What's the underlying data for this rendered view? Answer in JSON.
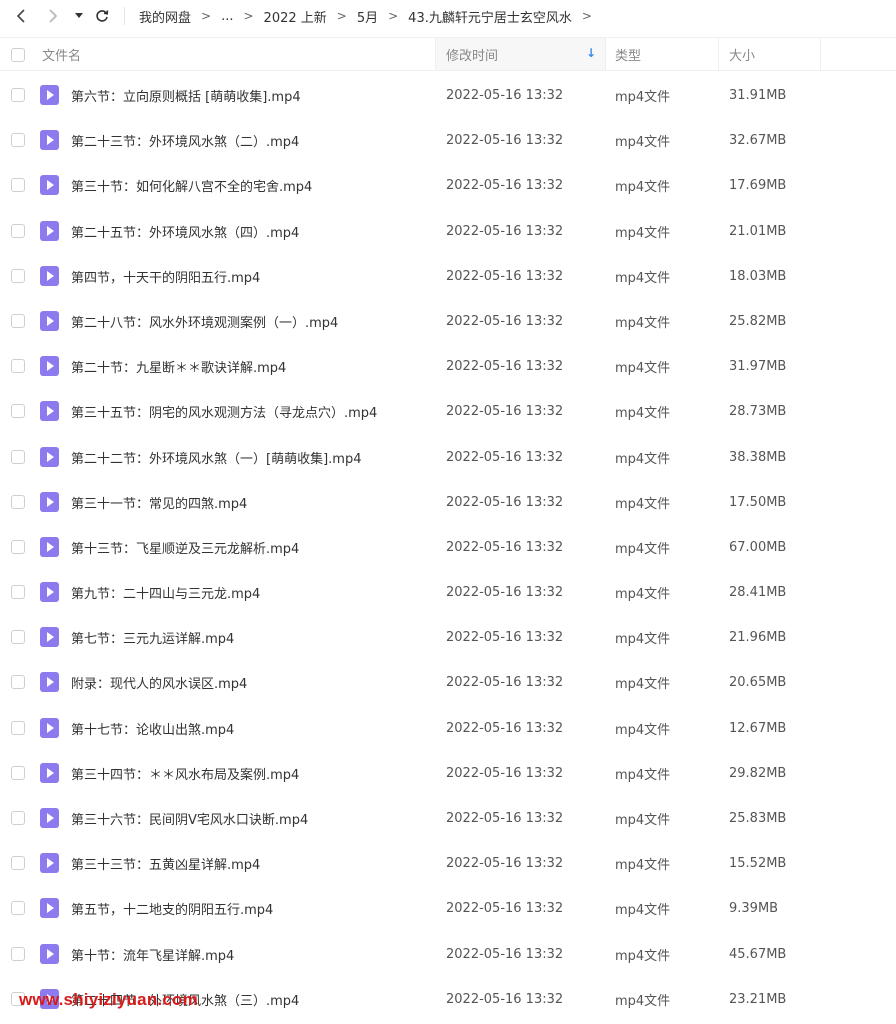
{
  "nav": {
    "back_icon": "chevron-left-icon",
    "forward_icon": "chevron-right-icon",
    "dropdown_icon": "caret-down-icon",
    "refresh_icon": "refresh-icon"
  },
  "breadcrumb": {
    "items": [
      "我的网盘",
      "...",
      "2022 上新",
      "5月",
      "43.九麟轩元宁居士玄空风水"
    ],
    "separator": ">"
  },
  "header": {
    "name": "文件名",
    "modified": "修改时间",
    "type": "类型",
    "size": "大小",
    "sort_indicator": "↓",
    "sort_color": "#3c8ae8"
  },
  "file_icon_color": "#8b7bef",
  "files": [
    {
      "name": "第六节：立向原则概括 [萌萌收集].mp4",
      "modified": "2022-05-16 13:32",
      "type": "mp4文件",
      "size": "31.91MB"
    },
    {
      "name": "第二十三节：外环境风水煞（二）.mp4",
      "modified": "2022-05-16 13:32",
      "type": "mp4文件",
      "size": "32.67MB"
    },
    {
      "name": "第三十节：如何化解八宫不全的宅舍.mp4",
      "modified": "2022-05-16 13:32",
      "type": "mp4文件",
      "size": "17.69MB"
    },
    {
      "name": "第二十五节：外环境风水煞（四）.mp4",
      "modified": "2022-05-16 13:32",
      "type": "mp4文件",
      "size": "21.01MB"
    },
    {
      "name": "第四节，十天干的阴阳五行.mp4",
      "modified": "2022-05-16 13:32",
      "type": "mp4文件",
      "size": "18.03MB"
    },
    {
      "name": "第二十八节：风水外环境观测案例（一）.mp4",
      "modified": "2022-05-16 13:32",
      "type": "mp4文件",
      "size": "25.82MB"
    },
    {
      "name": "第二十节：九星断＊＊歌诀详解.mp4",
      "modified": "2022-05-16 13:32",
      "type": "mp4文件",
      "size": "31.97MB"
    },
    {
      "name": "第三十五节：阴宅的风水观测方法（寻龙点穴）.mp4",
      "modified": "2022-05-16 13:32",
      "type": "mp4文件",
      "size": "28.73MB"
    },
    {
      "name": "第二十二节：外环境风水煞（一）[萌萌收集].mp4",
      "modified": "2022-05-16 13:32",
      "type": "mp4文件",
      "size": "38.38MB"
    },
    {
      "name": "第三十一节：常见的四煞.mp4",
      "modified": "2022-05-16 13:32",
      "type": "mp4文件",
      "size": "17.50MB"
    },
    {
      "name": "第十三节：飞星顺逆及三元龙解析.mp4",
      "modified": "2022-05-16 13:32",
      "type": "mp4文件",
      "size": "67.00MB"
    },
    {
      "name": "第九节：二十四山与三元龙.mp4",
      "modified": "2022-05-16 13:32",
      "type": "mp4文件",
      "size": "28.41MB"
    },
    {
      "name": "第七节：三元九运详解.mp4",
      "modified": "2022-05-16 13:32",
      "type": "mp4文件",
      "size": "21.96MB"
    },
    {
      "name": "附录：现代人的风水误区.mp4",
      "modified": "2022-05-16 13:32",
      "type": "mp4文件",
      "size": "20.65MB"
    },
    {
      "name": "第十七节：论收山出煞.mp4",
      "modified": "2022-05-16 13:32",
      "type": "mp4文件",
      "size": "12.67MB"
    },
    {
      "name": "第三十四节：＊＊风水布局及案例.mp4",
      "modified": "2022-05-16 13:32",
      "type": "mp4文件",
      "size": "29.82MB"
    },
    {
      "name": "第三十六节：民间阴V宅风水口诀断.mp4",
      "modified": "2022-05-16 13:32",
      "type": "mp4文件",
      "size": "25.83MB"
    },
    {
      "name": "第三十三节：五黄凶星详解.mp4",
      "modified": "2022-05-16 13:32",
      "type": "mp4文件",
      "size": "15.52MB"
    },
    {
      "name": "第五节，十二地支的阴阳五行.mp4",
      "modified": "2022-05-16 13:32",
      "type": "mp4文件",
      "size": "9.39MB"
    },
    {
      "name": "第十节：流年飞星详解.mp4",
      "modified": "2022-05-16 13:32",
      "type": "mp4文件",
      "size": "45.67MB"
    },
    {
      "name": "第二十四节：外环境风水煞（三）.mp4",
      "modified": "2022-05-16 13:32",
      "type": "mp4文件",
      "size": "23.21MB"
    }
  ],
  "watermark": {
    "text": "www.shiyiziyuan.com",
    "color": "#d81b1b"
  }
}
